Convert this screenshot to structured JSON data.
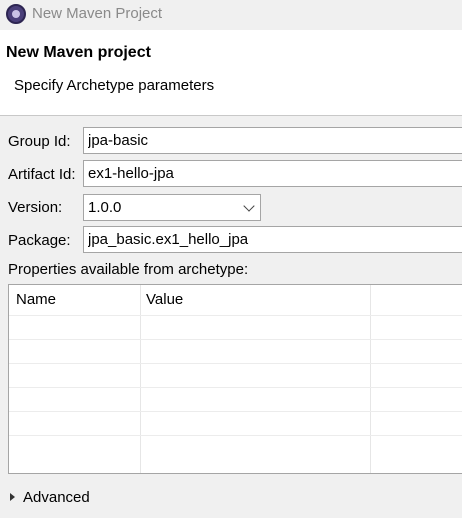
{
  "window": {
    "title": "New Maven Project",
    "icon": "maven-app-icon"
  },
  "header": {
    "title": "New Maven project",
    "subtitle": "Specify Archetype parameters"
  },
  "form": {
    "group_id": {
      "label": "Group Id:",
      "value": "jpa-basic"
    },
    "artifact_id": {
      "label": "Artifact Id:",
      "value": "ex1-hello-jpa"
    },
    "version": {
      "label": "Version:",
      "value": "1.0.0"
    },
    "package": {
      "label": "Package:",
      "value": "jpa_basic.ex1_hello_jpa"
    }
  },
  "properties": {
    "label": "Properties available from archetype:",
    "columns": [
      "Name",
      "Value"
    ],
    "rows": []
  },
  "advanced": {
    "label": "Advanced"
  }
}
